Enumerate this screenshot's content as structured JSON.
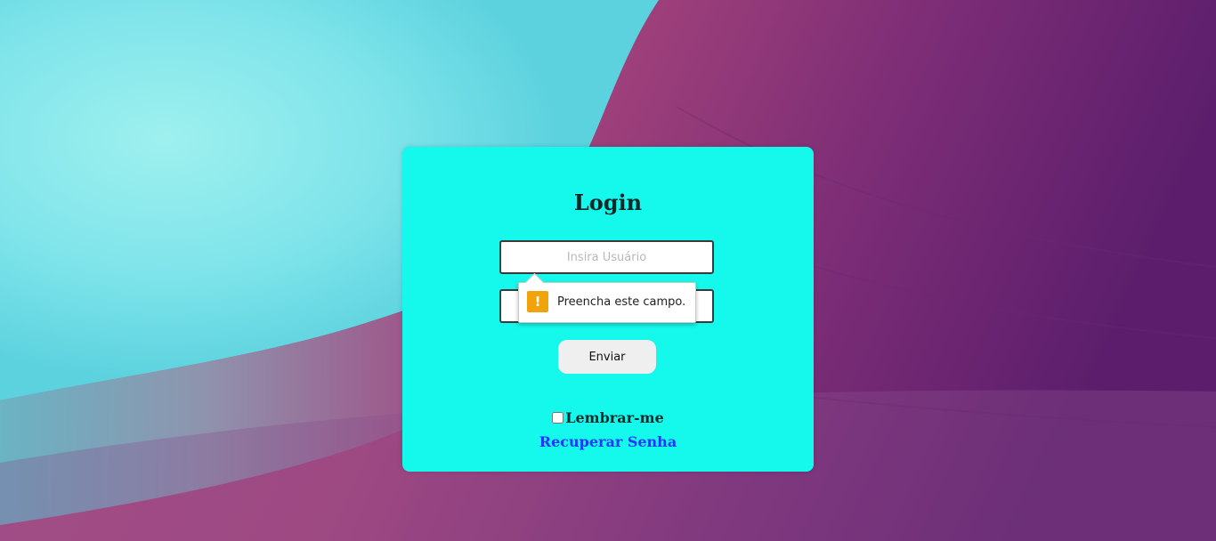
{
  "login": {
    "title": "Login",
    "username_placeholder": "Insira Usuário",
    "submit_label": "Enviar",
    "remember_label": "Lembrar-me",
    "recover_link": "Recuperar Senha"
  },
  "validation_tooltip": {
    "icon": "warning-icon",
    "message": "Preencha este campo."
  },
  "colors": {
    "card_background": "#15f8ec",
    "link": "#1a3aff",
    "warning": "#f0a30a"
  }
}
